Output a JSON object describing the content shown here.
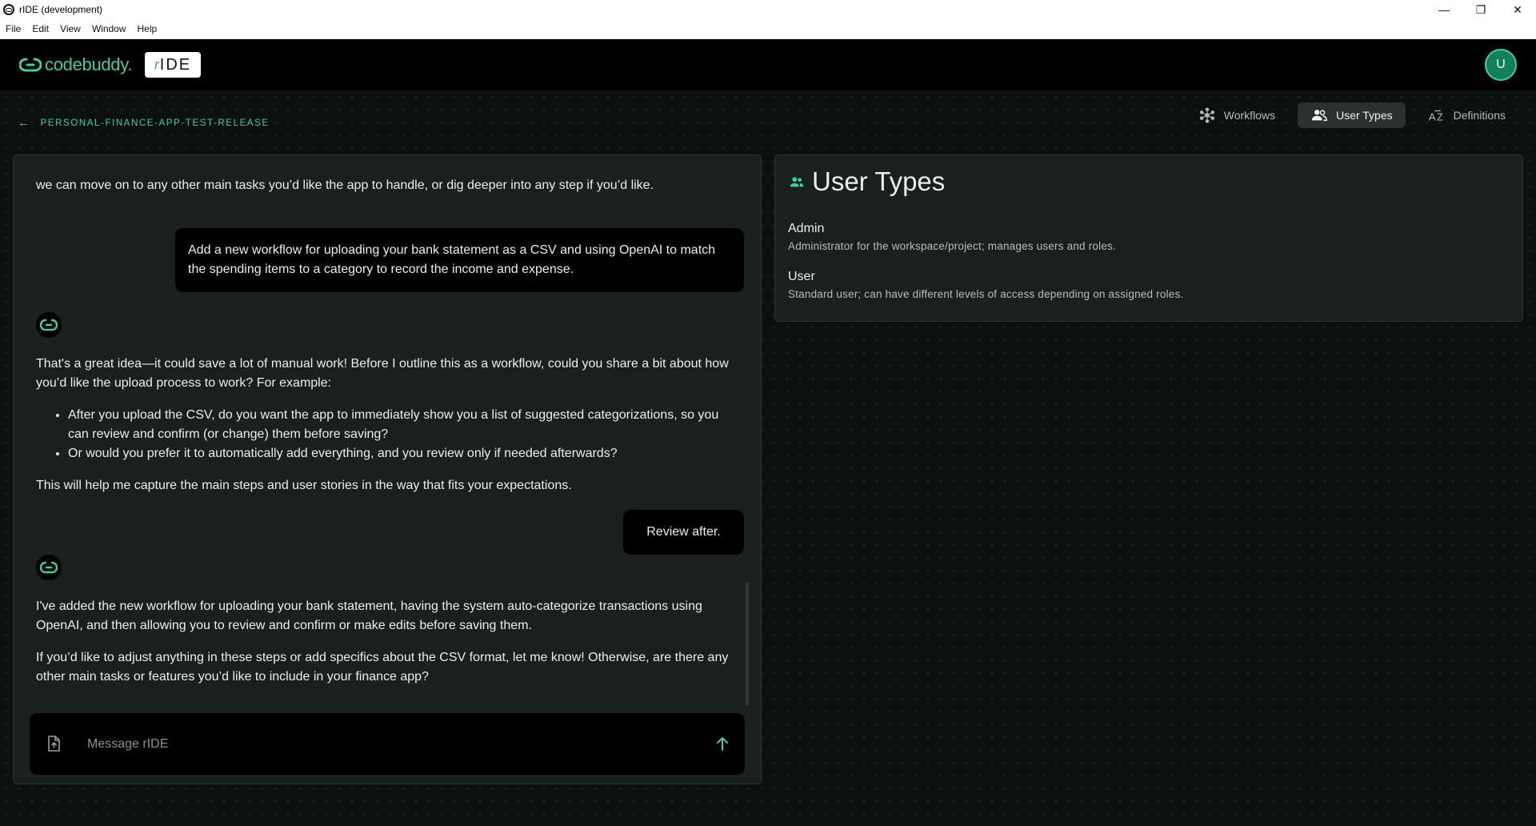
{
  "window": {
    "title": "rIDE (development)",
    "controls": [
      "minimize",
      "restore",
      "close"
    ]
  },
  "menu": [
    "File",
    "Edit",
    "View",
    "Window",
    "Help"
  ],
  "header": {
    "logo_text": "codebuddy.",
    "badge_r": "r",
    "badge_text": "IDE",
    "avatar_initial": "U"
  },
  "breadcrumb": {
    "project": "PERSONAL-FINANCE-APP-TEST-RELEASE"
  },
  "nav": {
    "tabs": [
      {
        "label": "Workflows",
        "icon": "workflows-icon",
        "active": false
      },
      {
        "label": "User Types",
        "icon": "users-icon",
        "active": true
      },
      {
        "label": "Definitions",
        "icon": "az-icon",
        "active": false
      }
    ]
  },
  "chat": {
    "messages": {
      "m1": "we can move on to any other main tasks you’d like the app to handle, or dig deeper into any step if you’d like.",
      "u1": "Add a new workflow for uploading your bank statement as a CSV and using OpenAI to match the spending items to a category to record the income and expense.",
      "b2_intro": "That's a great idea—it could save a lot of manual work! Before I outline this as a workflow, could you share a bit about how you’d like the upload process to work? For example:",
      "b2_bullet1": "After you upload the CSV, do you want the app to immediately show you a list of suggested categorizations, so you can review and confirm (or change) them before saving?",
      "b2_bullet2": "Or would you prefer it to automatically add everything, and you review only if needed afterwards?",
      "b2_outro": "This will help me capture the main steps and user stories in the way that fits your expectations.",
      "u2": "Review after.",
      "b3_p1": "I've added the new workflow for uploading your bank statement, having the system auto-categorize transactions using OpenAI, and then allowing you to review and confirm or make edits before saving them.",
      "b3_p2": "If you’d like to adjust anything in these steps or add specifics about the CSV format, let me know! Otherwise, are there any other main tasks or features you’d like to include in your finance app?"
    },
    "composer": {
      "placeholder": "Message rIDE",
      "value": ""
    }
  },
  "user_types": {
    "title": "User Types",
    "items": [
      {
        "name": "Admin",
        "description": "Administrator for the workspace/project; manages users and roles."
      },
      {
        "name": "User",
        "description": "Standard user; can have different levels of access depending on assigned roles."
      }
    ]
  },
  "colors": {
    "accent": "#3ecf9e",
    "background": "#0d1010",
    "panel": "#1a1f1f",
    "bubble": "#000000"
  }
}
